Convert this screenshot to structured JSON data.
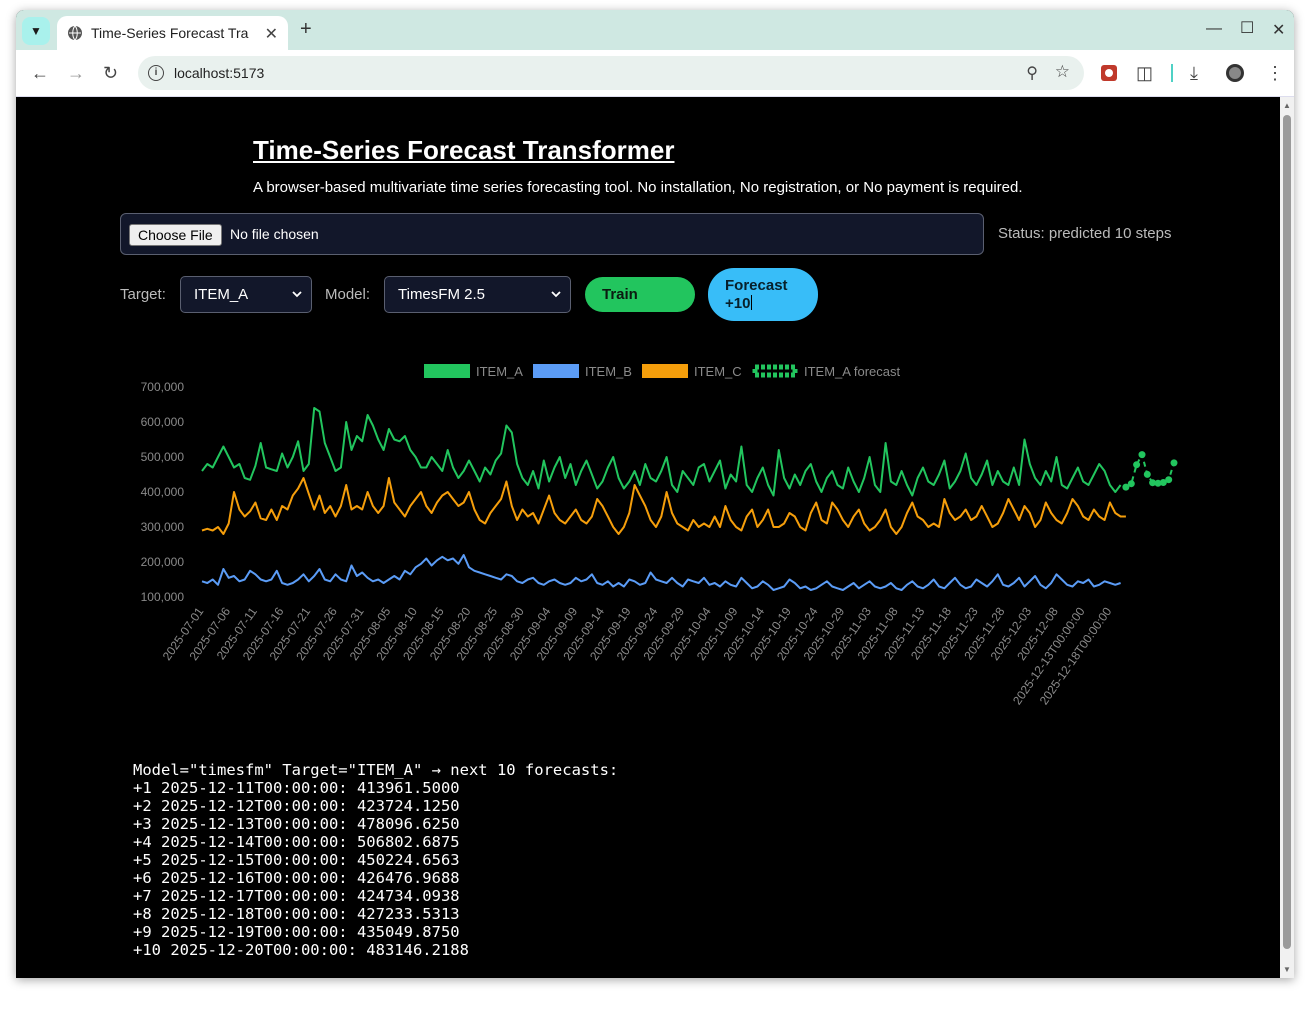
{
  "browser": {
    "tab_title": "Time-Series Forecast Tra",
    "url": "localhost:5173"
  },
  "app": {
    "title": "Time-Series Forecast Transformer",
    "subtitle": "A browser-based multivariate time series forecasting tool. No installation, No registration, or No payment is required.",
    "file_button": "Choose File",
    "file_status": "No file chosen",
    "status": "Status: predicted 10 steps",
    "target_label": "Target:",
    "target_value": "ITEM_A",
    "model_label": "Model:",
    "model_value": "TimesFM 2.5",
    "train_label": "Train",
    "forecast_label_1": "Forecast",
    "forecast_label_2": "+10"
  },
  "chart_data": {
    "type": "line",
    "legend_position": "top",
    "colors": {
      "ITEM_A": "#22c55e",
      "ITEM_B": "#5b9cf6",
      "ITEM_C": "#f59e0b",
      "ITEM_A forecast": "#22c55e"
    },
    "series_names": [
      "ITEM_A",
      "ITEM_B",
      "ITEM_C",
      "ITEM_A forecast"
    ],
    "yticks": [
      "700,000",
      "600,000",
      "500,000",
      "400,000",
      "300,000",
      "200,000",
      "100,000"
    ],
    "ylim": [
      100000,
      700000
    ],
    "xticks": [
      "2025-07-01",
      "2025-07-06",
      "2025-07-11",
      "2025-07-16",
      "2025-07-21",
      "2025-07-26",
      "2025-07-31",
      "2025-08-05",
      "2025-08-10",
      "2025-08-15",
      "2025-08-20",
      "2025-08-25",
      "2025-08-30",
      "2025-09-04",
      "2025-09-09",
      "2025-09-14",
      "2025-09-19",
      "2025-09-24",
      "2025-09-29",
      "2025-10-04",
      "2025-10-09",
      "2025-10-14",
      "2025-10-19",
      "2025-10-24",
      "2025-10-29",
      "2025-11-03",
      "2025-11-08",
      "2025-11-13",
      "2025-11-18",
      "2025-11-23",
      "2025-11-28",
      "2025-12-03",
      "2025-12-08",
      "2025-12-13T00:00:00",
      "2025-12-18T00:00:00"
    ],
    "num_days": 173,
    "series": [
      {
        "name": "ITEM_A",
        "values": [
          460000,
          480000,
          470000,
          500000,
          530000,
          500000,
          470000,
          480000,
          440000,
          435000,
          475000,
          540000,
          470000,
          465000,
          460000,
          510000,
          470000,
          500000,
          545000,
          460000,
          480000,
          640000,
          630000,
          540000,
          500000,
          460000,
          470000,
          600000,
          520000,
          560000,
          545000,
          620000,
          590000,
          550000,
          520000,
          580000,
          550000,
          545000,
          560000,
          520000,
          500000,
          470000,
          470000,
          500000,
          480000,
          460000,
          520000,
          470000,
          440000,
          460000,
          490000,
          460000,
          430000,
          470000,
          450000,
          490000,
          510000,
          590000,
          570000,
          480000,
          440000,
          420000,
          460000,
          410000,
          490000,
          430000,
          470000,
          500000,
          440000,
          480000,
          420000,
          460000,
          490000,
          450000,
          410000,
          430000,
          470000,
          500000,
          440000,
          410000,
          430000,
          460000,
          420000,
          480000,
          440000,
          430000,
          460000,
          500000,
          420000,
          400000,
          460000,
          440000,
          420000,
          470000,
          480000,
          430000,
          460000,
          490000,
          410000,
          450000,
          430000,
          530000,
          420000,
          400000,
          440000,
          470000,
          420000,
          390000,
          520000,
          440000,
          410000,
          450000,
          420000,
          460000,
          480000,
          430000,
          400000,
          440000,
          460000,
          420000,
          410000,
          470000,
          430000,
          400000,
          440000,
          500000,
          420000,
          400000,
          540000,
          430000,
          420000,
          460000,
          420000,
          390000,
          440000,
          470000,
          430000,
          420000,
          450000,
          490000,
          410000,
          430000,
          460000,
          510000,
          440000,
          420000,
          450000,
          490000,
          420000,
          460000,
          430000,
          420000,
          470000,
          420000,
          550000,
          480000,
          440000,
          420000,
          460000,
          430000,
          500000,
          420000,
          410000,
          440000,
          470000,
          430000,
          420000,
          450000,
          480000,
          460000,
          420000,
          400000,
          420000
        ],
        "values_note": "ITEM_A"
      },
      {
        "name": "ITEM_B",
        "values": [
          145000,
          140000,
          150000,
          135000,
          180000,
          155000,
          160000,
          145000,
          150000,
          175000,
          165000,
          150000,
          145000,
          150000,
          175000,
          140000,
          135000,
          140000,
          150000,
          165000,
          145000,
          160000,
          180000,
          150000,
          145000,
          165000,
          150000,
          145000,
          190000,
          160000,
          170000,
          155000,
          145000,
          150000,
          140000,
          150000,
          160000,
          150000,
          175000,
          165000,
          185000,
          195000,
          210000,
          190000,
          205000,
          215000,
          205000,
          210000,
          195000,
          220000,
          185000,
          175000,
          170000,
          165000,
          160000,
          155000,
          150000,
          165000,
          160000,
          145000,
          140000,
          150000,
          155000,
          140000,
          135000,
          145000,
          150000,
          140000,
          135000,
          140000,
          155000,
          145000,
          150000,
          165000,
          140000,
          135000,
          145000,
          130000,
          140000,
          130000,
          150000,
          145000,
          135000,
          140000,
          170000,
          150000,
          145000,
          140000,
          155000,
          140000,
          130000,
          150000,
          145000,
          140000,
          155000,
          135000,
          140000,
          130000,
          145000,
          135000,
          130000,
          155000,
          140000,
          125000,
          130000,
          145000,
          135000,
          120000,
          125000,
          130000,
          150000,
          140000,
          125000,
          130000,
          120000,
          125000,
          135000,
          145000,
          130000,
          125000,
          120000,
          130000,
          140000,
          125000,
          135000,
          145000,
          130000,
          125000,
          130000,
          140000,
          125000,
          120000,
          135000,
          145000,
          130000,
          125000,
          135000,
          150000,
          130000,
          125000,
          140000,
          155000,
          135000,
          125000,
          130000,
          150000,
          140000,
          130000,
          145000,
          165000,
          135000,
          130000,
          140000,
          155000,
          130000,
          145000,
          160000,
          135000,
          125000,
          140000,
          165000,
          150000,
          135000,
          130000,
          145000,
          140000,
          150000,
          130000,
          135000,
          145000,
          140000,
          135000,
          140000
        ],
        "values_note": "ITEM_B"
      },
      {
        "name": "ITEM_C",
        "values": [
          290000,
          295000,
          290000,
          300000,
          280000,
          310000,
          400000,
          350000,
          330000,
          345000,
          370000,
          325000,
          320000,
          350000,
          320000,
          360000,
          350000,
          390000,
          410000,
          440000,
          395000,
          350000,
          390000,
          340000,
          360000,
          330000,
          360000,
          420000,
          350000,
          360000,
          350000,
          400000,
          360000,
          340000,
          360000,
          440000,
          370000,
          350000,
          330000,
          360000,
          380000,
          400000,
          360000,
          340000,
          370000,
          390000,
          400000,
          380000,
          360000,
          370000,
          400000,
          350000,
          320000,
          310000,
          340000,
          360000,
          380000,
          430000,
          360000,
          320000,
          350000,
          330000,
          340000,
          310000,
          350000,
          390000,
          340000,
          320000,
          310000,
          330000,
          350000,
          320000,
          310000,
          330000,
          380000,
          360000,
          330000,
          300000,
          280000,
          300000,
          340000,
          420000,
          390000,
          360000,
          320000,
          300000,
          330000,
          400000,
          340000,
          310000,
          300000,
          290000,
          320000,
          300000,
          310000,
          300000,
          330000,
          300000,
          360000,
          320000,
          300000,
          290000,
          330000,
          350000,
          300000,
          320000,
          350000,
          300000,
          300000,
          310000,
          340000,
          330000,
          300000,
          290000,
          340000,
          370000,
          320000,
          310000,
          370000,
          350000,
          320000,
          300000,
          330000,
          350000,
          310000,
          290000,
          300000,
          320000,
          350000,
          300000,
          280000,
          300000,
          340000,
          370000,
          330000,
          320000,
          300000,
          310000,
          300000,
          380000,
          340000,
          320000,
          330000,
          350000,
          320000,
          330000,
          360000,
          330000,
          300000,
          310000,
          340000,
          380000,
          350000,
          320000,
          360000,
          340000,
          300000,
          320000,
          370000,
          340000,
          320000,
          310000,
          340000,
          380000,
          360000,
          330000,
          320000,
          350000,
          330000,
          320000,
          370000,
          340000,
          330000,
          330000
        ],
        "values_note": "ITEM_C"
      },
      {
        "name": "ITEM_A forecast",
        "values": [
          413961.5,
          423724.125,
          478096.625,
          506802.6875,
          450224.6563,
          426476.9688,
          424734.0938,
          427233.5313,
          435049.875,
          483146.2188
        ]
      }
    ]
  },
  "output": {
    "header": "Model=\"timesfm\" Target=\"ITEM_A\" → next 10 forecasts:",
    "lines": [
      "+1 2025-12-11T00:00:00: 413961.5000",
      "+2 2025-12-12T00:00:00: 423724.1250",
      "+3 2025-12-13T00:00:00: 478096.6250",
      "+4 2025-12-14T00:00:00: 506802.6875",
      "+5 2025-12-15T00:00:00: 450224.6563",
      "+6 2025-12-16T00:00:00: 426476.9688",
      "+7 2025-12-17T00:00:00: 424734.0938",
      "+8 2025-12-18T00:00:00: 427233.5313",
      "+9 2025-12-19T00:00:00: 435049.8750",
      "+10 2025-12-20T00:00:00: 483146.2188"
    ]
  }
}
